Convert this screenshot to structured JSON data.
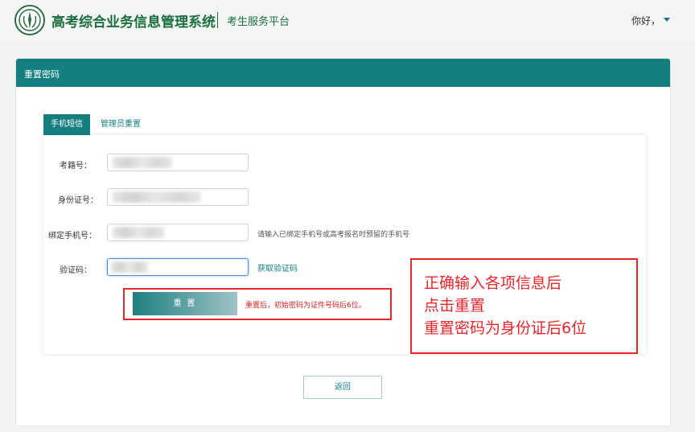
{
  "header": {
    "system_title": "高考综合业务信息管理系统",
    "subtitle": "考生服务平台",
    "greeting": "你好，",
    "logo_icon": "emblem-icon"
  },
  "panel": {
    "title": "重置密码",
    "header_color": "#147e80"
  },
  "tabs": [
    {
      "label": "手机短信",
      "active": true
    },
    {
      "label": "管理员重置",
      "active": false
    }
  ],
  "form": {
    "exam_no_label": "考籍号：",
    "id_no_label": "身份证号：",
    "phone_label": "绑定手机号：",
    "phone_hint": "请输入已绑定手机号或高考报名时预留的手机号",
    "code_label": "验证码：",
    "get_code_label": "获取验证码",
    "reset_button": "重 置",
    "reset_note": "重置后，初始密码为证件号码后6位。"
  },
  "annotation": {
    "line1": "正确输入各项信息后",
    "line2": "点击重置",
    "line3": "重置密码为身份证后6位",
    "color": "#e8262b"
  },
  "back_button": "返回"
}
